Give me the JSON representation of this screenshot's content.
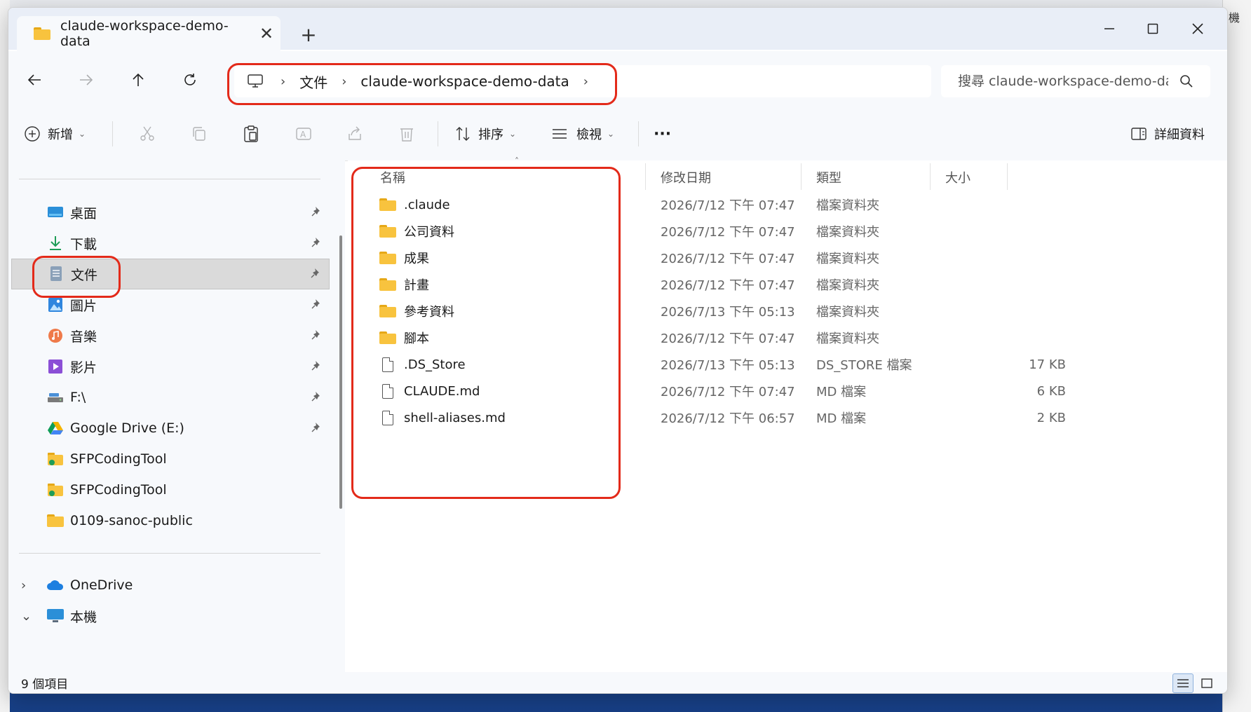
{
  "window": {
    "tab_title": "claude-workspace-demo-data",
    "tab_close": "✕",
    "new_tab": "+"
  },
  "breadcrumb": [
    "文件",
    "claude-workspace-demo-data"
  ],
  "search": {
    "placeholder": "搜尋 claude-workspace-demo-da"
  },
  "toolbar": {
    "new_label": "新增",
    "sort_label": "排序",
    "view_label": "檢視",
    "more_label": "···",
    "details_label": "詳細資料"
  },
  "sidebar": {
    "items": [
      {
        "label": "桌面",
        "icon": "desktop-icon",
        "pinned": true
      },
      {
        "label": "下載",
        "icon": "download-icon",
        "pinned": true
      },
      {
        "label": "文件",
        "icon": "documents-icon",
        "pinned": true,
        "selected": true
      },
      {
        "label": "圖片",
        "icon": "pictures-icon",
        "pinned": true
      },
      {
        "label": "音樂",
        "icon": "music-icon",
        "pinned": true
      },
      {
        "label": "影片",
        "icon": "videos-icon",
        "pinned": true
      },
      {
        "label": "F:\\",
        "icon": "drive-icon",
        "pinned": true
      },
      {
        "label": "Google Drive (E:)",
        "icon": "google-drive-icon",
        "pinned": true
      },
      {
        "label": "SFPCodingTool",
        "icon": "shared-folder-icon",
        "pinned": false
      },
      {
        "label": "SFPCodingTool",
        "icon": "shared-folder-icon",
        "pinned": false
      },
      {
        "label": "0109-sanoc-public",
        "icon": "folder-icon",
        "pinned": false
      }
    ],
    "onedrive": "OneDrive",
    "this_pc": "本機"
  },
  "columns": {
    "name": "名稱",
    "modified": "修改日期",
    "type": "類型",
    "size": "大小"
  },
  "files": [
    {
      "name": ".claude",
      "modified": "2026/7/12 下午 07:47",
      "type": "檔案資料夾",
      "size": "",
      "kind": "folder"
    },
    {
      "name": "公司資料",
      "modified": "2026/7/12 下午 07:47",
      "type": "檔案資料夾",
      "size": "",
      "kind": "folder"
    },
    {
      "name": "成果",
      "modified": "2026/7/12 下午 07:47",
      "type": "檔案資料夾",
      "size": "",
      "kind": "folder"
    },
    {
      "name": "計畫",
      "modified": "2026/7/12 下午 07:47",
      "type": "檔案資料夾",
      "size": "",
      "kind": "folder"
    },
    {
      "name": "參考資料",
      "modified": "2026/7/13 下午 05:13",
      "type": "檔案資料夾",
      "size": "",
      "kind": "folder"
    },
    {
      "name": "腳本",
      "modified": "2026/7/12 下午 07:47",
      "type": "檔案資料夾",
      "size": "",
      "kind": "folder"
    },
    {
      "name": ".DS_Store",
      "modified": "2026/7/13 下午 05:13",
      "type": "DS_STORE 檔案",
      "size": "17 KB",
      "kind": "file"
    },
    {
      "name": "CLAUDE.md",
      "modified": "2026/7/12 下午 07:47",
      "type": "MD 檔案",
      "size": "6 KB",
      "kind": "file"
    },
    {
      "name": "shell-aliases.md",
      "modified": "2026/7/12 下午 06:57",
      "type": "MD 檔案",
      "size": "2 KB",
      "kind": "file"
    }
  ],
  "status": {
    "item_count": "9 個項目"
  },
  "bg": {
    "corner_glyph": "機"
  }
}
